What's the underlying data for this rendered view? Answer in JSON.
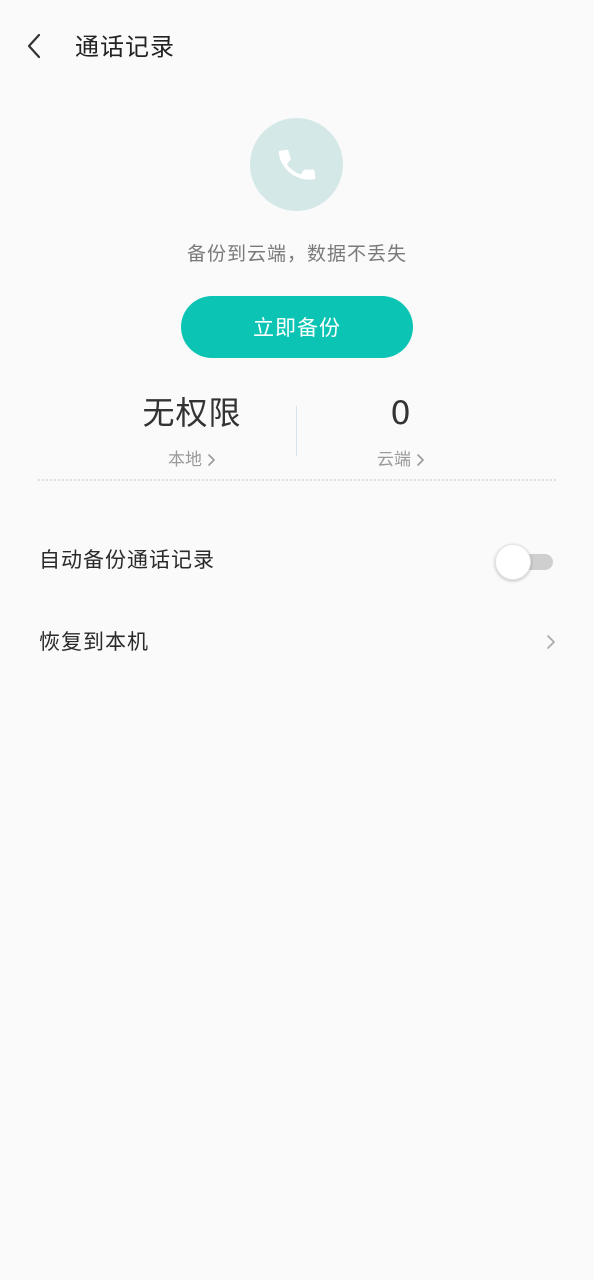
{
  "header": {
    "title": "通话记录",
    "back_icon": "chevron-left-icon"
  },
  "hero": {
    "icon": "phone-icon",
    "tagline": "备份到云端，数据不丢失",
    "backup_button_label": "立即备份"
  },
  "stats": {
    "local": {
      "value": "无权限",
      "label": "本地"
    },
    "cloud": {
      "value": "0",
      "label": "云端"
    }
  },
  "settings": {
    "auto_backup": {
      "label": "自动备份通话记录",
      "enabled": false
    },
    "restore": {
      "label": "恢复到本机"
    }
  },
  "colors": {
    "accent": "#0cc4b4",
    "icon_circle": "#d4e8e7",
    "background": "#fafafa"
  }
}
